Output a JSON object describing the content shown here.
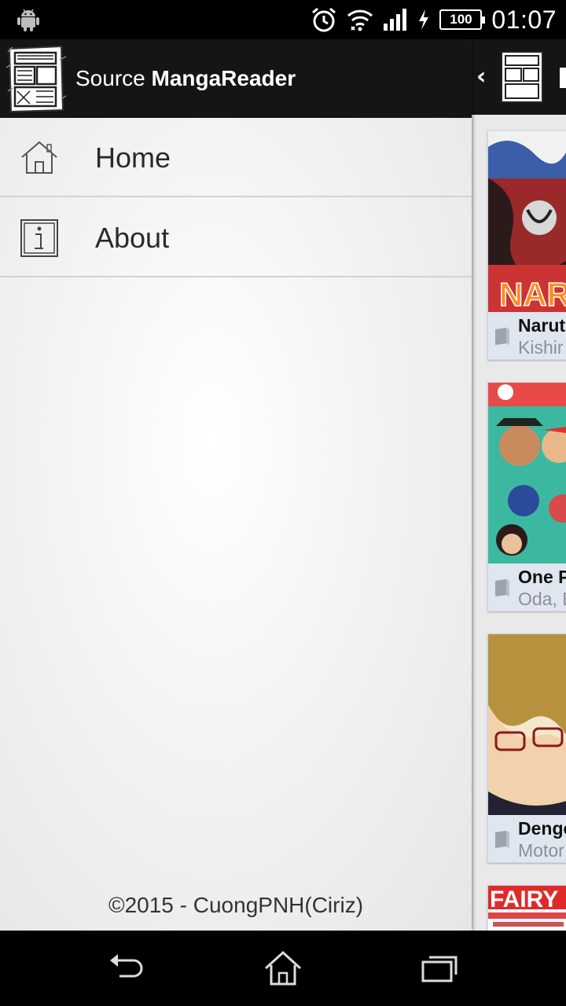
{
  "status_bar": {
    "battery": "100",
    "time": "01:07",
    "icons": [
      "android-icon",
      "alarm-icon",
      "wifi-icon",
      "signal-icon",
      "charging-icon",
      "battery-icon"
    ]
  },
  "drawer": {
    "header": {
      "prefix": "Source",
      "source_name": "MangaReader"
    },
    "items": [
      {
        "label": "Home",
        "icon": "home-icon"
      },
      {
        "label": "About",
        "icon": "info-icon"
      }
    ],
    "footer": "©2015 - CuongPNH(Ciriz)"
  },
  "main": {
    "cards": [
      {
        "title": "Narut",
        "author": "Kishir"
      },
      {
        "title": "One P",
        "author": "Oda, E"
      },
      {
        "title": "Denge",
        "author": "Motor"
      }
    ]
  },
  "colors": {
    "action_bar": "#151515",
    "info_panel": "#e0e6ef",
    "divider": "#d2d2d2"
  }
}
